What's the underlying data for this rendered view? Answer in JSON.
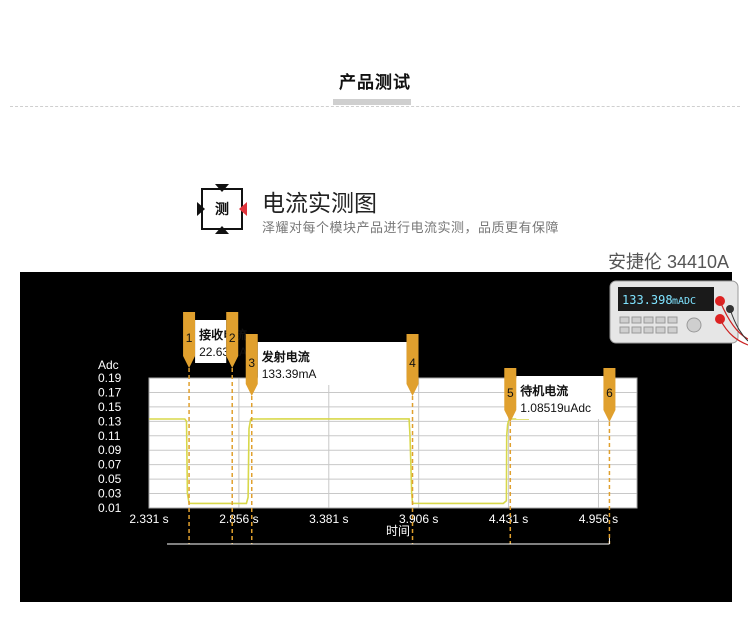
{
  "section": {
    "title": "产品测试"
  },
  "badge": {
    "char": "测"
  },
  "heading": {
    "title": "电流实测图",
    "subtitle": "泽耀对每个模块产品进行电流实测，品质更有保障"
  },
  "instrument": {
    "name": "安捷伦 34410A",
    "display_value": "133.398",
    "display_unit": "mADC"
  },
  "colors": {
    "accent_orange": "#e0a02e",
    "trace_yellow": "#d8d84a",
    "badge_red": "#e0333b",
    "panel_bg": "#000000"
  },
  "chart_data": {
    "type": "line",
    "ylabel": "Adc",
    "xlabel": "时间",
    "xlim": [
      2.331,
      5.181
    ],
    "ylim": [
      0.01,
      0.19
    ],
    "x_ticks": [
      2.331,
      2.856,
      3.381,
      3.906,
      4.431,
      4.956
    ],
    "x_tick_labels": [
      "2.331 s",
      "2.856 s",
      "3.381 s",
      "3.906 s",
      "4.431 s",
      "4.956 s"
    ],
    "y_ticks": [
      0.19,
      0.17,
      0.15,
      0.13,
      0.11,
      0.09,
      0.07,
      0.05,
      0.03,
      0.01
    ],
    "y_tick_labels": [
      "0.19",
      "0.17",
      "0.15",
      "0.13",
      "0.11",
      "0.09",
      "0.07",
      "0.05",
      "0.03",
      "0.01"
    ],
    "grid": true,
    "series": [
      {
        "x": [
          2.331,
          2.54,
          2.55,
          2.555,
          2.565,
          2.6,
          2.8,
          2.9,
          2.91,
          2.915,
          2.925,
          3.1,
          3.3,
          3.5,
          3.7,
          3.85,
          3.855,
          3.865,
          3.87,
          4.0,
          4.2,
          4.4,
          4.418,
          4.42,
          4.425,
          4.43,
          4.44,
          4.55
        ],
        "y": [
          0.1332,
          0.1332,
          0.13,
          0.03,
          0.0165,
          0.0163,
          0.0163,
          0.0163,
          0.025,
          0.12,
          0.1332,
          0.1334,
          0.1333,
          0.1334,
          0.1333,
          0.1333,
          0.11,
          0.03,
          0.0165,
          0.0163,
          0.0163,
          0.0163,
          0.02,
          0.11,
          0.125,
          0.13,
          0.1332,
          0.1332
        ]
      }
    ],
    "markers": [
      {
        "label": "1",
        "x": 2.565
      },
      {
        "label": "2",
        "x": 2.817
      },
      {
        "label": "3",
        "x": 2.931
      },
      {
        "label": "4",
        "x": 3.87
      },
      {
        "label": "5",
        "x": 4.441
      },
      {
        "label": "6",
        "x": 5.02
      }
    ],
    "annotations": [
      {
        "title": "接收电流",
        "value": "22.63mA",
        "from": 0,
        "to": 1
      },
      {
        "title": "发射电流",
        "value": "133.39mA",
        "from": 2,
        "to": 3
      },
      {
        "title": "待机电流",
        "value": "1.08519uAdc",
        "from": 4,
        "to": 5
      }
    ]
  }
}
